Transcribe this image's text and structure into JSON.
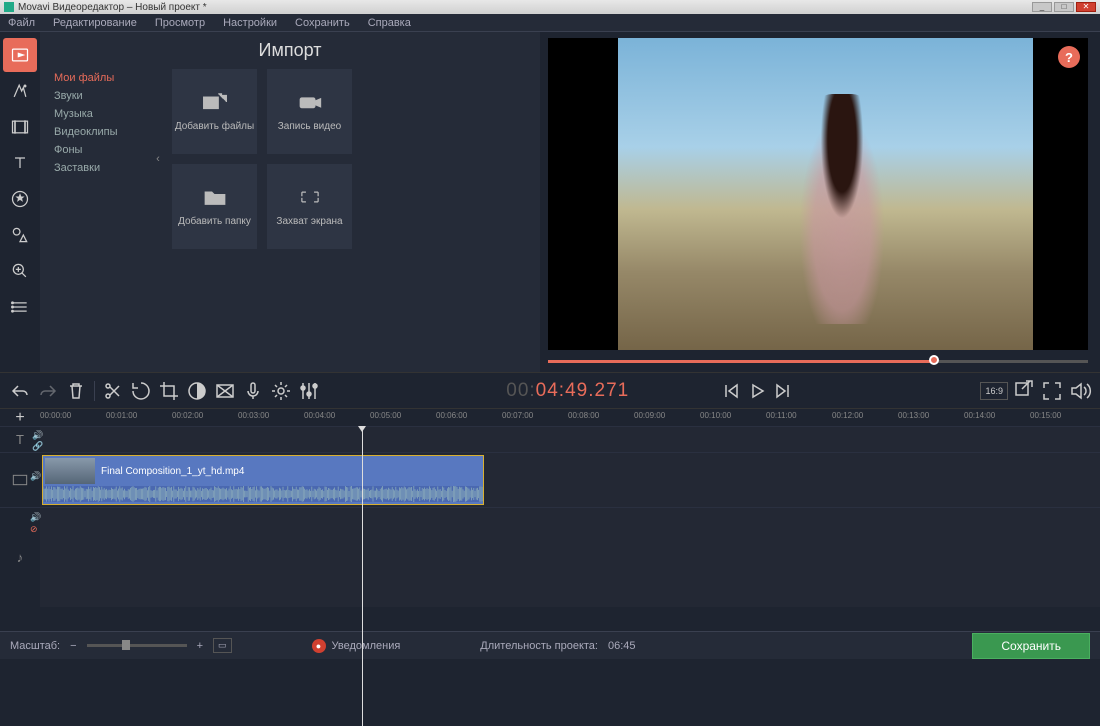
{
  "window": {
    "title": "Movavi Видеоредактор – Новый проект *"
  },
  "menu": [
    "Файл",
    "Редактирование",
    "Просмотр",
    "Настройки",
    "Сохранить",
    "Справка"
  ],
  "import": {
    "title": "Импорт",
    "categories": [
      "Мои файлы",
      "Звуки",
      "Музыка",
      "Видеоклипы",
      "Фоны",
      "Заставки"
    ],
    "tiles": {
      "add_files": "Добавить файлы",
      "record_video": "Запись видео",
      "add_folder": "Добавить папку",
      "screen_capture": "Захват экрана"
    }
  },
  "preview": {
    "help": "?"
  },
  "timecode": {
    "dim": "00:",
    "bright": "04:49.271"
  },
  "aspect": "16:9",
  "ruler": [
    "00:00:00",
    "00:01:00",
    "00:02:00",
    "00:03:00",
    "00:04:00",
    "00:05:00",
    "00:06:00",
    "00:07:00",
    "00:08:00",
    "00:09:00",
    "00:10:00",
    "00:11:00",
    "00:12:00",
    "00:13:00",
    "00:14:00",
    "00:15:00"
  ],
  "clip": {
    "name": "Final Composition_1_yt_hd.mp4"
  },
  "bottom": {
    "zoom_label": "Масштаб:",
    "notifications": "Уведомления",
    "duration_label": "Длительность проекта:",
    "duration_value": "06:45",
    "save": "Сохранить"
  }
}
